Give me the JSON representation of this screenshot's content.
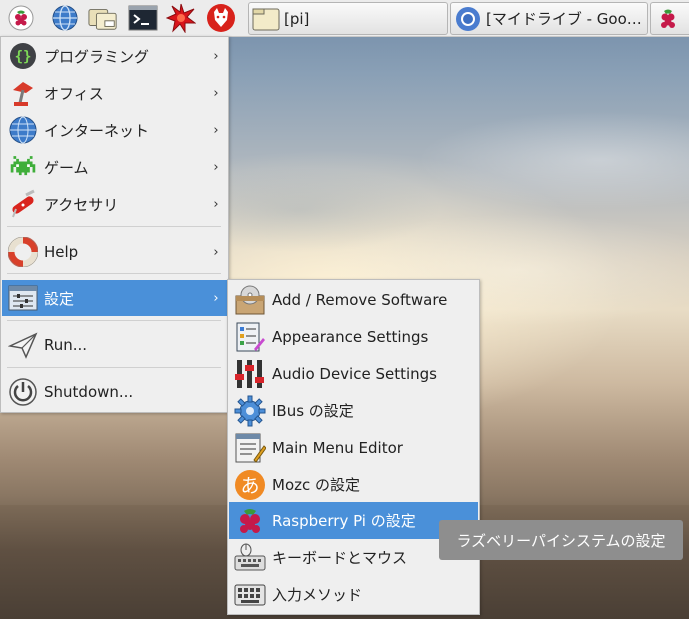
{
  "taskbar": {
    "launchers": [
      {
        "name": "raspberry-menu-icon"
      },
      {
        "name": "web-browser-icon"
      },
      {
        "name": "file-manager-icon"
      },
      {
        "name": "terminal-icon"
      },
      {
        "name": "mathematica-icon"
      },
      {
        "name": "wolfram-icon"
      }
    ],
    "tasks": [
      {
        "label": "[pi]",
        "icon": "folder-icon"
      },
      {
        "label": "[マイドライブ - Goo…",
        "icon": "chromium-icon"
      }
    ]
  },
  "main_menu": {
    "items": [
      {
        "label": "プログラミング",
        "icon": "programming-icon",
        "submenu": true
      },
      {
        "label": "オフィス",
        "icon": "office-icon",
        "submenu": true
      },
      {
        "label": "インターネット",
        "icon": "internet-icon",
        "submenu": true
      },
      {
        "label": "ゲーム",
        "icon": "games-icon",
        "submenu": true
      },
      {
        "label": "アクセサリ",
        "icon": "accessories-icon",
        "submenu": true
      },
      {
        "label": "Help",
        "icon": "help-icon",
        "submenu": true
      },
      {
        "label": "設定",
        "icon": "preferences-icon",
        "submenu": true,
        "active": true
      },
      {
        "label": "Run...",
        "icon": "run-icon",
        "submenu": false
      },
      {
        "label": "Shutdown...",
        "icon": "shutdown-icon",
        "submenu": false
      }
    ],
    "arrow": "›"
  },
  "submenu": {
    "items": [
      {
        "label": "Add / Remove Software",
        "icon": "software-icon"
      },
      {
        "label": "Appearance Settings",
        "icon": "appearance-icon"
      },
      {
        "label": "Audio Device Settings",
        "icon": "audio-icon"
      },
      {
        "label": "IBus の設定",
        "icon": "ibus-icon"
      },
      {
        "label": "Main Menu Editor",
        "icon": "menu-editor-icon"
      },
      {
        "label": "Mozc の設定",
        "icon": "mozc-icon"
      },
      {
        "label": "Raspberry Pi の設定",
        "icon": "raspberry-config-icon",
        "active": true
      },
      {
        "label": "キーボードとマウス",
        "icon": "keyboard-mouse-icon"
      },
      {
        "label": "入力メソッド",
        "icon": "input-method-icon"
      }
    ]
  },
  "tooltip": {
    "text": "ラズベリーパイシステムの設定"
  },
  "colors": {
    "highlight": "#4a90d9",
    "menu_bg": "#efefef",
    "tooltip_bg": "#8e8e8e"
  }
}
